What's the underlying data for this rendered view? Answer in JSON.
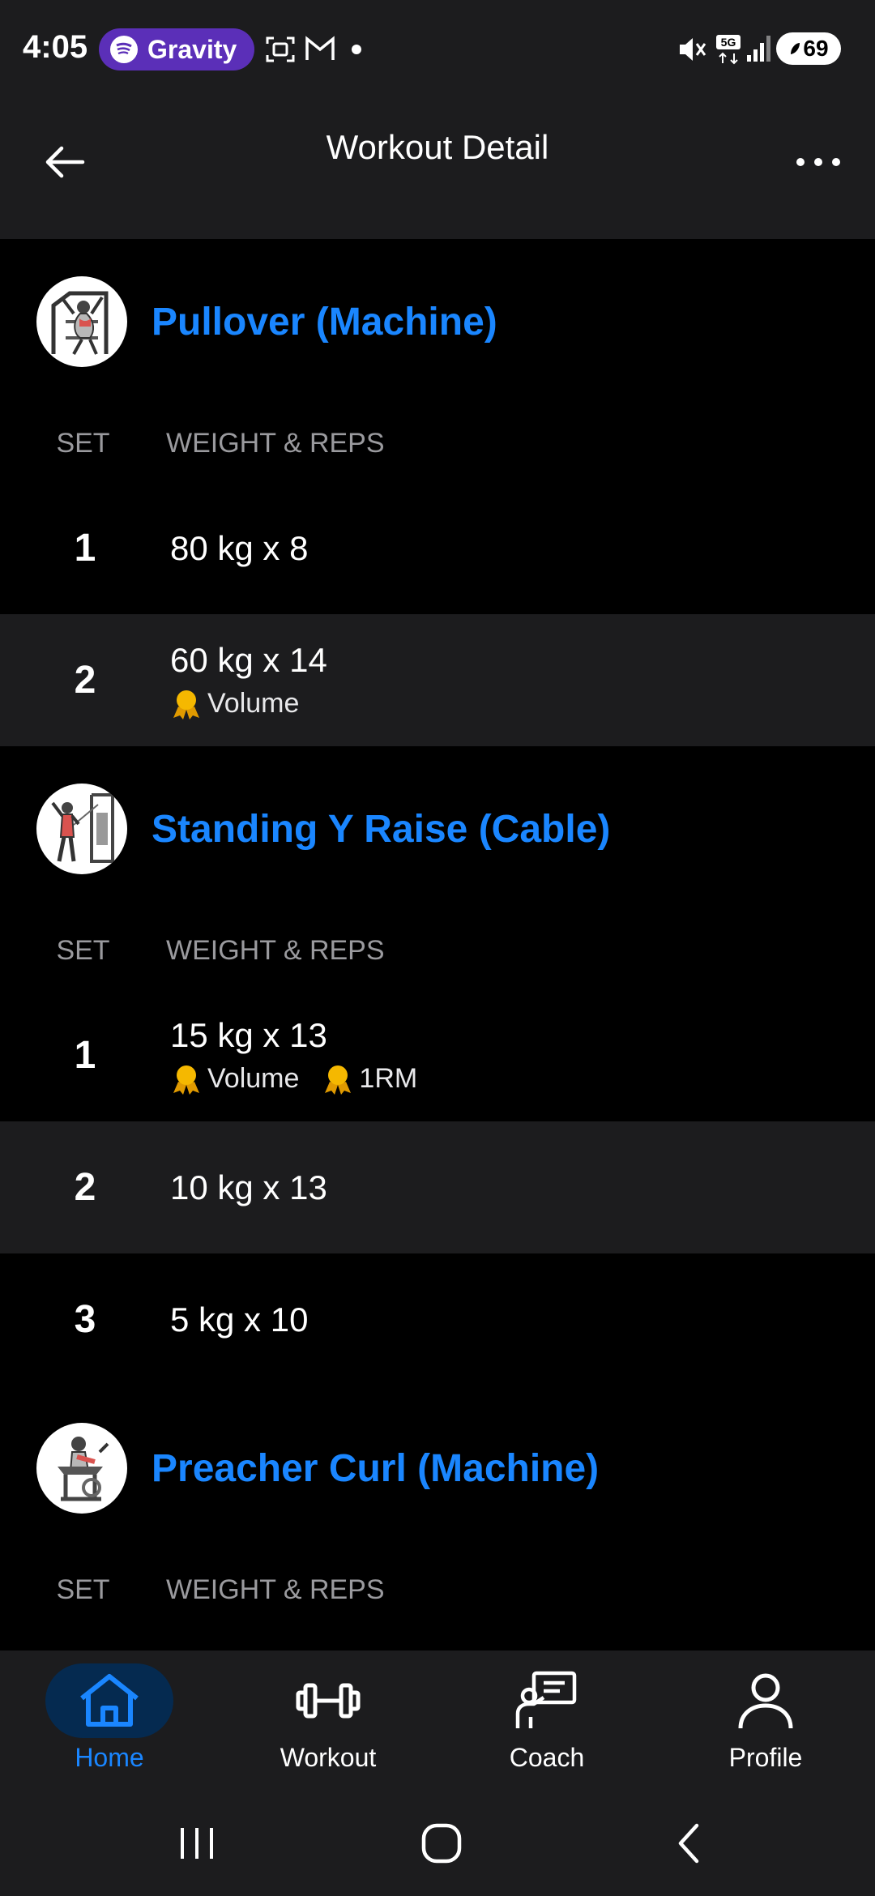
{
  "status_bar": {
    "time": "4:05",
    "app_pill": "Gravity",
    "battery": "69"
  },
  "header": {
    "title": "Workout Detail"
  },
  "columns": {
    "set": "SET",
    "weight_reps": "WEIGHT & REPS"
  },
  "exercises": [
    {
      "name": "Pullover (Machine)",
      "sets": [
        {
          "num": "1",
          "value": "80 kg x 8"
        },
        {
          "num": "2",
          "value": "60 kg x 14",
          "badges": [
            "Volume"
          ]
        }
      ]
    },
    {
      "name": "Standing Y Raise (Cable)",
      "sets": [
        {
          "num": "1",
          "value": "15 kg x 13",
          "badges": [
            "Volume",
            "1RM"
          ]
        },
        {
          "num": "2",
          "value": "10 kg x 13"
        },
        {
          "num": "3",
          "value": "5 kg x 10"
        }
      ]
    },
    {
      "name": "Preacher Curl (Machine)"
    }
  ],
  "nav": {
    "home": "Home",
    "workout": "Workout",
    "coach": "Coach",
    "profile": "Profile"
  },
  "colors": {
    "accent": "#1a86ff",
    "background": "#000000",
    "surface": "#1c1c1e",
    "medal": "#f5b800"
  }
}
